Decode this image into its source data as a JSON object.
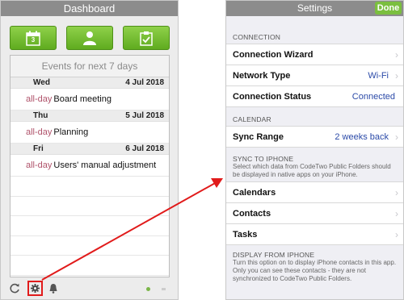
{
  "dashboard": {
    "title": "Dashboard",
    "calendar_day": "3",
    "events_header": "Events for next 7 days",
    "days": [
      {
        "weekday": "Wed",
        "date": "4 Jul 2018",
        "event_tag": "all-day",
        "event_title": "Board meeting"
      },
      {
        "weekday": "Thu",
        "date": "5 Jul 2018",
        "event_tag": "all-day",
        "event_title": "Planning"
      },
      {
        "weekday": "Fri",
        "date": "6 Jul 2018",
        "event_tag": "all-day",
        "event_title": "Users' manual adjustment"
      }
    ],
    "colors": {
      "accent_green": "#6cbf2a",
      "highlight_red": "#e11b1b"
    },
    "icons": [
      "calendar-icon",
      "user-icon",
      "clipboard-check-icon",
      "refresh-icon",
      "gear-icon",
      "bell-icon"
    ]
  },
  "settings": {
    "title": "Settings",
    "done_label": "Done",
    "connection": {
      "header": "CONNECTION",
      "wizard_label": "Connection Wizard",
      "network_label": "Network Type",
      "network_value": "Wi-Fi",
      "status_label": "Connection Status",
      "status_value": "Connected"
    },
    "calendar": {
      "header": "CALENDAR",
      "sync_label": "Sync Range",
      "sync_value": "2 weeks back"
    },
    "sync": {
      "header": "SYNC TO IPHONE",
      "note": "Select which data from CodeTwo Public Folders should be displayed in native apps on your iPhone.",
      "calendars_label": "Calendars",
      "contacts_label": "Contacts",
      "tasks_label": "Tasks"
    },
    "display": {
      "header": "DISPLAY FROM IPHONE",
      "note": "Turn this option on to display iPhone contacts in this app. Only you can see these contacts - they are not synchronized to CodeTwo Public Folders."
    }
  }
}
